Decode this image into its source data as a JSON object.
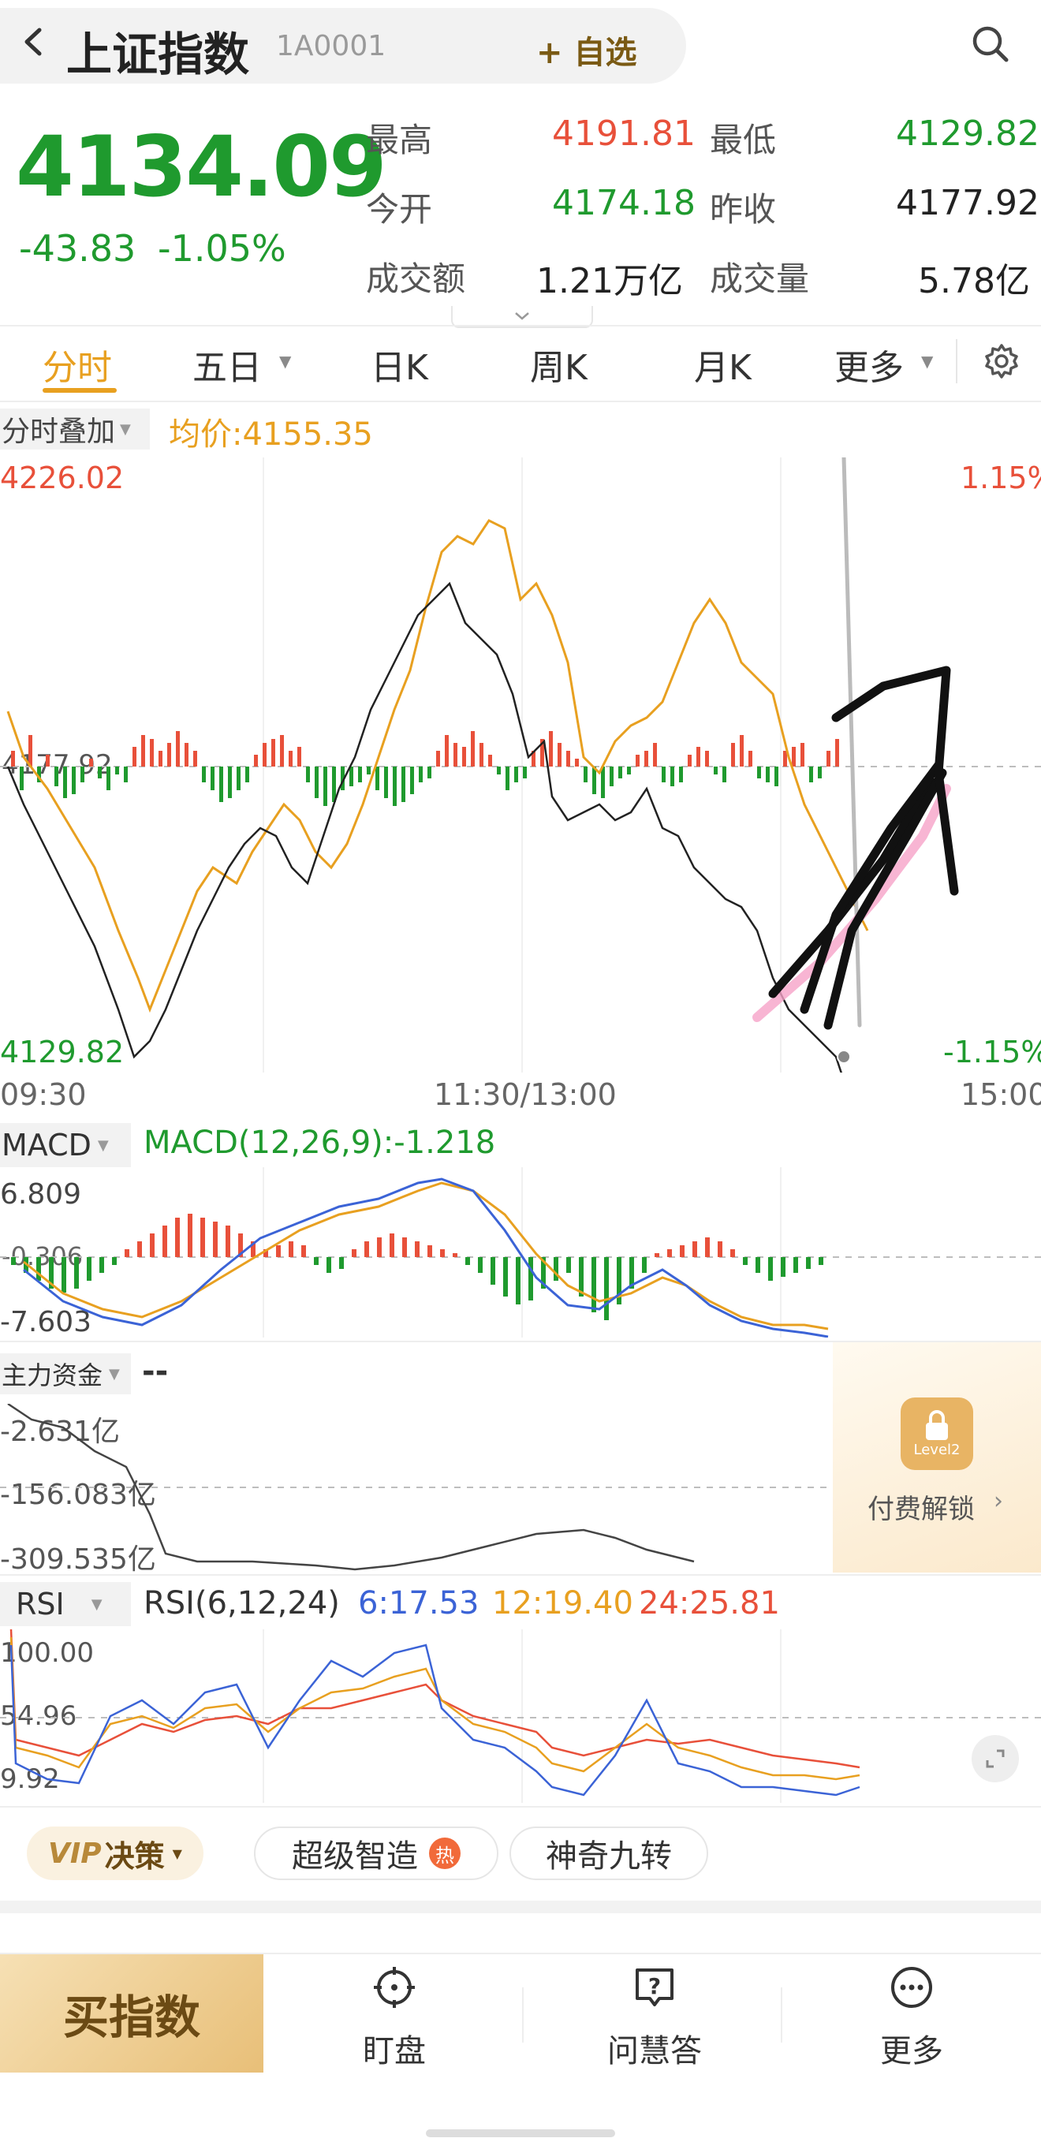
{
  "header": {
    "back_icon": "chevron-left-icon",
    "title": "上证指数",
    "code": "1A0001",
    "add_label": "+ 自选",
    "search_icon": "search-icon"
  },
  "quote": {
    "price": "4134.09",
    "change": "-43.83",
    "change_pct": "-1.05%",
    "stats": [
      {
        "label": "最高",
        "value": "4191.81"
      },
      {
        "label": "最低",
        "value": "4129.82"
      },
      {
        "label": "今开",
        "value": "4174.18"
      },
      {
        "label": "昨收",
        "value": "4177.92"
      },
      {
        "label": "成交额",
        "value": "1.21万亿"
      },
      {
        "label": "成交量",
        "value": "5.78亿"
      }
    ]
  },
  "tabs": [
    "分时",
    "五日",
    "日K",
    "周K",
    "月K",
    "更多"
  ],
  "tabs_settings_icon": "gear-icon",
  "intraday": {
    "overlay_label": "分时叠加",
    "avg_label": "均价:4155.35",
    "top_value": "4226.02",
    "top_pct": "1.15%",
    "mid_value": "4177.92",
    "bottom_value": "4129.82",
    "bottom_pct": "-1.15%",
    "time_labels": [
      "09:30",
      "11:30/13:00",
      "15:00"
    ]
  },
  "macd": {
    "label": "MACD",
    "params": "MACD(12,26,9):-1.218",
    "top": "6.809",
    "mid": "-0.306",
    "bottom": "-7.603"
  },
  "capital": {
    "label": "主力资金",
    "value": "--",
    "top": "-2.631亿",
    "mid": "-156.083亿",
    "bottom": "-309.535亿",
    "lock_badge": "Level2",
    "unlock_label": "付费解锁"
  },
  "rsi": {
    "label": "RSI",
    "params": "RSI(6,12,24)",
    "r6": "6:17.53",
    "r12": "12:19.40",
    "r24": "24:25.81",
    "top": "100.00",
    "mid": "54.96",
    "bottom": "9.92"
  },
  "chips": {
    "vip": "决策",
    "smart": "超级智造",
    "hot": "热",
    "nine": "神奇九转"
  },
  "bottom_nav": {
    "buy": "买指数",
    "items": [
      "盯盘",
      "问慧答",
      "更多"
    ]
  },
  "colors": {
    "red": "#e8503a",
    "green": "#1f9a2e",
    "orange": "#e8a020",
    "blue": "#3b63d6",
    "gold": "#d4a24a"
  }
}
